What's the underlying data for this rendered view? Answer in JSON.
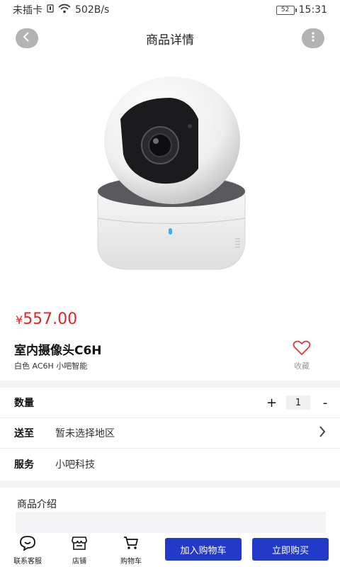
{
  "status_bar": {
    "carrier": "未插卡",
    "speed": "502B/s",
    "battery": "52",
    "time": "15:31"
  },
  "header": {
    "title": "商品详情",
    "back_icon": "chevron-left-icon",
    "more_icon": "more-vertical-icon"
  },
  "product": {
    "currency": "¥",
    "price": "557.00",
    "name": "室内摄像头C6H",
    "description": "白色 AC6H 小吧智能",
    "favorite_label": "收藏",
    "favorite_icon": "heart-icon"
  },
  "options": {
    "quantity_label": "数量",
    "quantity_plus": "+",
    "quantity_value": "1",
    "quantity_minus": "-",
    "ship_label": "送至",
    "ship_value": "暂未选择地区",
    "service_label": "服务",
    "service_value": "小吧科技"
  },
  "intro": {
    "label": "商品介绍"
  },
  "bottom_bar": {
    "tabs": [
      {
        "label": "联系客服",
        "icon": "chat-icon"
      },
      {
        "label": "店铺",
        "icon": "store-icon"
      },
      {
        "label": "购物车",
        "icon": "cart-icon"
      }
    ],
    "add_to_cart": "加入购物车",
    "buy_now": "立即购买"
  },
  "colors": {
    "price": "#e0261e",
    "primary_button": "#233ac9",
    "heart": "#d93a3a"
  }
}
